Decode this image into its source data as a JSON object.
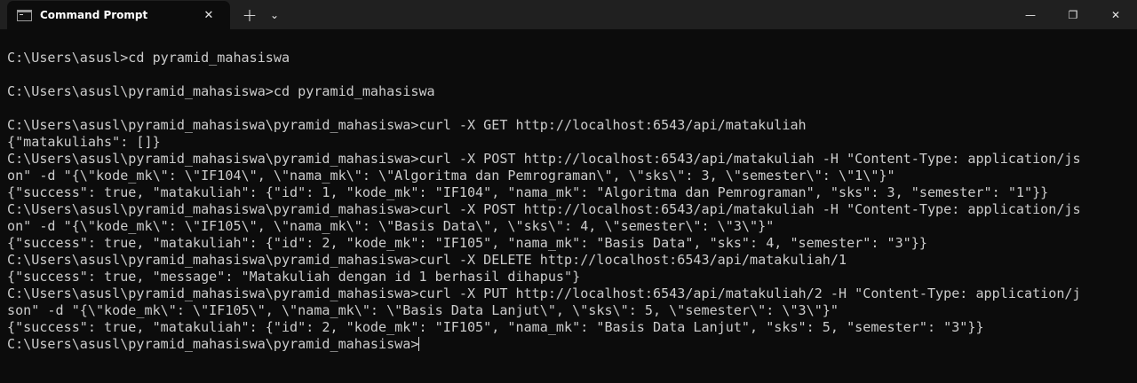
{
  "window": {
    "tab_title": "Command Prompt",
    "tab_close_glyph": "✕",
    "new_tab_glyph": "+",
    "dropdown_glyph": "⌄",
    "minimize_glyph": "—",
    "maximize_glyph": "❐",
    "close_glyph": "✕"
  },
  "terminal": {
    "lines": [
      "C:\\Users\\asusl>cd pyramid_mahasiswa",
      "",
      "C:\\Users\\asusl\\pyramid_mahasiswa>cd pyramid_mahasiswa",
      "",
      "C:\\Users\\asusl\\pyramid_mahasiswa\\pyramid_mahasiswa>curl -X GET http://localhost:6543/api/matakuliah",
      "{\"matakuliahs\": []}",
      "C:\\Users\\asusl\\pyramid_mahasiswa\\pyramid_mahasiswa>curl -X POST http://localhost:6543/api/matakuliah -H \"Content-Type: application/js",
      "on\" -d \"{\\\"kode_mk\\\": \\\"IF104\\\", \\\"nama_mk\\\": \\\"Algoritma dan Pemrograman\\\", \\\"sks\\\": 3, \\\"semester\\\": \\\"1\\\"}\"",
      "{\"success\": true, \"matakuliah\": {\"id\": 1, \"kode_mk\": \"IF104\", \"nama_mk\": \"Algoritma dan Pemrograman\", \"sks\": 3, \"semester\": \"1\"}}",
      "C:\\Users\\asusl\\pyramid_mahasiswa\\pyramid_mahasiswa>curl -X POST http://localhost:6543/api/matakuliah -H \"Content-Type: application/js",
      "on\" -d \"{\\\"kode_mk\\\": \\\"IF105\\\", \\\"nama_mk\\\": \\\"Basis Data\\\", \\\"sks\\\": 4, \\\"semester\\\": \\\"3\\\"}\"",
      "{\"success\": true, \"matakuliah\": {\"id\": 2, \"kode_mk\": \"IF105\", \"nama_mk\": \"Basis Data\", \"sks\": 4, \"semester\": \"3\"}}",
      "C:\\Users\\asusl\\pyramid_mahasiswa\\pyramid_mahasiswa>curl -X DELETE http://localhost:6543/api/matakuliah/1",
      "{\"success\": true, \"message\": \"Matakuliah dengan id 1 berhasil dihapus\"}",
      "C:\\Users\\asusl\\pyramid_mahasiswa\\pyramid_mahasiswa>curl -X PUT http://localhost:6543/api/matakuliah/2 -H \"Content-Type: application/j",
      "son\" -d \"{\\\"kode_mk\\\": \\\"IF105\\\", \\\"nama_mk\\\": \\\"Basis Data Lanjut\\\", \\\"sks\\\": 5, \\\"semester\\\": \\\"3\\\"}\"",
      "{\"success\": true, \"matakuliah\": {\"id\": 2, \"kode_mk\": \"IF105\", \"nama_mk\": \"Basis Data Lanjut\", \"sks\": 5, \"semester\": \"3\"}}",
      "C:\\Users\\asusl\\pyramid_mahasiswa\\pyramid_mahasiswa>"
    ]
  }
}
